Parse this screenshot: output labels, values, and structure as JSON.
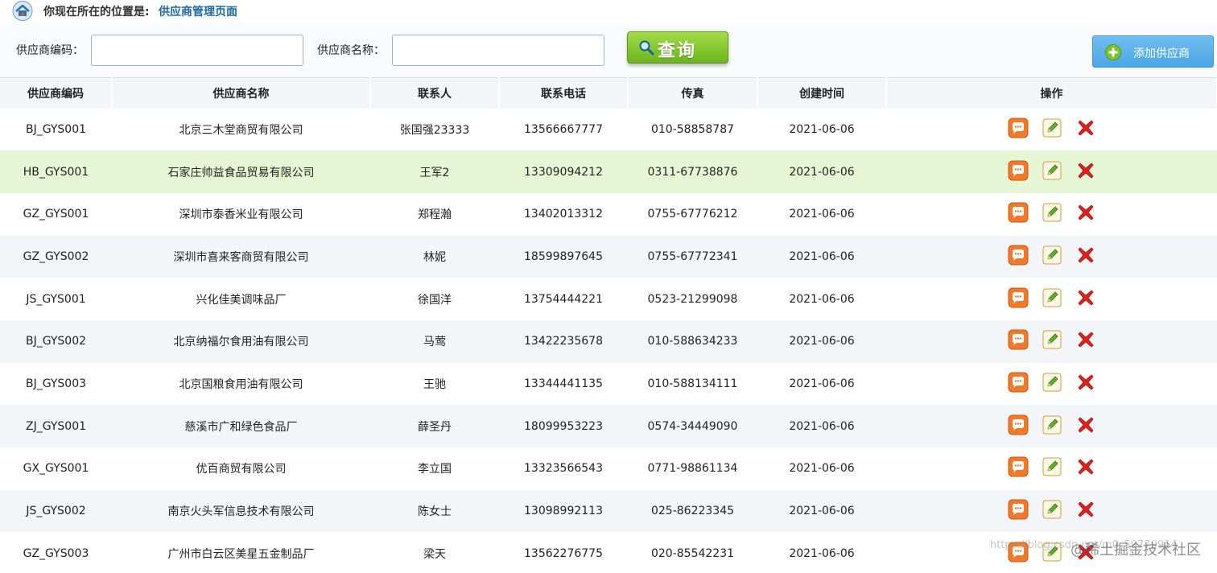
{
  "breadcrumb": {
    "prefix": "你现在所在的位置是:",
    "current": "供应商管理页面"
  },
  "search": {
    "code_label": "供应商编码：",
    "code_value": "",
    "name_label": "供应商名称：",
    "name_value": "",
    "query_label": "查询",
    "add_label": "添加供应商"
  },
  "table": {
    "headers": [
      "供应商编码",
      "供应商名称",
      "联系人",
      "联系电话",
      "传真",
      "创建时间",
      "操作"
    ],
    "rows": [
      [
        "BJ_GYS001",
        "北京三木堂商贸有限公司",
        "张国强23333",
        "13566667777",
        "010-58858787",
        "2021-06-06"
      ],
      [
        "HB_GYS001",
        "石家庄帅益食品贸易有限公司",
        "王军2",
        "13309094212",
        "0311-67738876",
        "2021-06-06"
      ],
      [
        "GZ_GYS001",
        "深圳市泰香米业有限公司",
        "郑程瀚",
        "13402013312",
        "0755-67776212",
        "2021-06-06"
      ],
      [
        "GZ_GYS002",
        "深圳市喜来客商贸有限公司",
        "林妮",
        "18599897645",
        "0755-67772341",
        "2021-06-06"
      ],
      [
        "JS_GYS001",
        "兴化佳美调味品厂",
        "徐国洋",
        "13754444221",
        "0523-21299098",
        "2021-06-06"
      ],
      [
        "BJ_GYS002",
        "北京纳福尔食用油有限公司",
        "马莺",
        "13422235678",
        "010-588634233",
        "2021-06-06"
      ],
      [
        "BJ_GYS003",
        "北京国粮食用油有限公司",
        "王驰",
        "13344441135",
        "010-588134111",
        "2021-06-06"
      ],
      [
        "ZJ_GYS001",
        "慈溪市广和绿色食品厂",
        "薛圣丹",
        "18099953223",
        "0574-34449090",
        "2021-06-06"
      ],
      [
        "GX_GYS001",
        "优百商贸有限公司",
        "李立国",
        "13323566543",
        "0771-98861134",
        "2021-06-06"
      ],
      [
        "JS_GYS002",
        "南京火头军信息技术有限公司",
        "陈女士",
        "13098992113",
        "025-86223345",
        "2021-06-06"
      ],
      [
        "GZ_GYS003",
        "广州市白云区美星五金制品厂",
        "梁天",
        "13562276775",
        "020-85542231",
        "2021-06-06"
      ]
    ],
    "row_action_icons": [
      "view-icon",
      "edit-icon",
      "delete-icon"
    ]
  },
  "watermark": {
    "url_text": "https://blog.csdn.net/m0_59779914",
    "site_text": "@稀土掘金技术社区"
  },
  "colors": {
    "highlight_row": "#e6f6d4",
    "stripe_row": "#f3f5f8",
    "query_button": "#7cc22a",
    "add_button": "#55aee8",
    "breadcrumb_current": "#1b6aa5"
  }
}
